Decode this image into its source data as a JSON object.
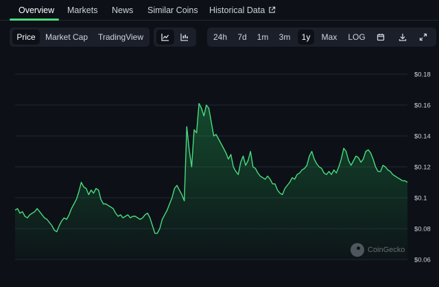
{
  "nav": {
    "tabs": [
      {
        "label": "Overview",
        "active": true
      },
      {
        "label": "Markets"
      },
      {
        "label": "News"
      },
      {
        "label": "Similar Coins"
      },
      {
        "label": "Historical Data"
      }
    ]
  },
  "toolbar": {
    "view_tabs": [
      {
        "label": "Price",
        "active": true
      },
      {
        "label": "Market Cap"
      },
      {
        "label": "TradingView"
      }
    ],
    "chart_types": [
      {
        "icon": "line-chart-icon",
        "active": true
      },
      {
        "icon": "candlestick-chart-icon"
      }
    ],
    "ranges": [
      {
        "label": "24h"
      },
      {
        "label": "7d"
      },
      {
        "label": "1m"
      },
      {
        "label": "3m"
      },
      {
        "label": "1y",
        "active": true
      },
      {
        "label": "Max"
      },
      {
        "label": "LOG"
      }
    ],
    "actions": [
      {
        "icon": "calendar-icon"
      },
      {
        "icon": "download-icon"
      },
      {
        "icon": "fullscreen-icon"
      }
    ]
  },
  "watermark": "CoinGecko",
  "colors": {
    "background": "#0d1117",
    "line": "#4ade80",
    "accent": "#4ade80",
    "gridline": "#1f2937"
  },
  "chart_data": {
    "type": "area",
    "y_ticks": [
      "$0.18",
      "$0.16",
      "$0.14",
      "$0.12",
      "$0.1",
      "$0.08",
      "$0.06"
    ],
    "ylim": [
      0.06,
      0.18
    ],
    "grid": true,
    "x": [
      0,
      1,
      2,
      3,
      4,
      5,
      6,
      7,
      8,
      9,
      10,
      11,
      12,
      13,
      14,
      15,
      16,
      17,
      18,
      19,
      20,
      21,
      22,
      23,
      24,
      25,
      26,
      27,
      28,
      29,
      30,
      31,
      32,
      33,
      34,
      35,
      36,
      37,
      38,
      39,
      40,
      41,
      42,
      43,
      44,
      45,
      46,
      47,
      48,
      49,
      50,
      51,
      52,
      53,
      54,
      55,
      56,
      57,
      58,
      59,
      60,
      61,
      62,
      63,
      64,
      65,
      66,
      67,
      68,
      69,
      70,
      71,
      72,
      73,
      74,
      75,
      76,
      77,
      78,
      79,
      80,
      81,
      82,
      83,
      84,
      85,
      86,
      87,
      88,
      89,
      90,
      91,
      92,
      93,
      94,
      95,
      96,
      97,
      98,
      99,
      100,
      101,
      102,
      103,
      104,
      105,
      106,
      107,
      108,
      109,
      110,
      111,
      112,
      113,
      114,
      115,
      116,
      117,
      118,
      119,
      120,
      121,
      122,
      123,
      124,
      125,
      126,
      127,
      128,
      129,
      130,
      131,
      132,
      133,
      134,
      135,
      136,
      137,
      138,
      139,
      140,
      141,
      142,
      143,
      144,
      145,
      146,
      147,
      148,
      149,
      150,
      151,
      152,
      153,
      154,
      155,
      156,
      157,
      158,
      159,
      160
    ],
    "series": [
      {
        "values": [
          0.092,
          0.093,
          0.09,
          0.091,
          0.088,
          0.087,
          0.089,
          0.09,
          0.091,
          0.093,
          0.091,
          0.089,
          0.087,
          0.086,
          0.084,
          0.082,
          0.079,
          0.078,
          0.082,
          0.085,
          0.087,
          0.086,
          0.089,
          0.093,
          0.096,
          0.099,
          0.104,
          0.11,
          0.107,
          0.106,
          0.102,
          0.105,
          0.103,
          0.106,
          0.105,
          0.099,
          0.096,
          0.096,
          0.095,
          0.094,
          0.093,
          0.09,
          0.088,
          0.089,
          0.087,
          0.088,
          0.089,
          0.087,
          0.088,
          0.088,
          0.087,
          0.086,
          0.087,
          0.089,
          0.09,
          0.087,
          0.082,
          0.077,
          0.077,
          0.08,
          0.086,
          0.089,
          0.092,
          0.096,
          0.1,
          0.106,
          0.108,
          0.105,
          0.102,
          0.098,
          0.146,
          0.131,
          0.12,
          0.144,
          0.142,
          0.161,
          0.158,
          0.153,
          0.16,
          0.158,
          0.149,
          0.14,
          0.141,
          0.138,
          0.135,
          0.132,
          0.129,
          0.125,
          0.128,
          0.12,
          0.117,
          0.115,
          0.123,
          0.127,
          0.121,
          0.124,
          0.13,
          0.12,
          0.119,
          0.116,
          0.114,
          0.113,
          0.112,
          0.114,
          0.112,
          0.109,
          0.109,
          0.105,
          0.103,
          0.102,
          0.106,
          0.108,
          0.11,
          0.113,
          0.112,
          0.115,
          0.116,
          0.118,
          0.119,
          0.121,
          0.127,
          0.13,
          0.125,
          0.122,
          0.12,
          0.119,
          0.116,
          0.115,
          0.117,
          0.115,
          0.118,
          0.116,
          0.12,
          0.125,
          0.132,
          0.13,
          0.124,
          0.121,
          0.124,
          0.127,
          0.126,
          0.123,
          0.125,
          0.13,
          0.131,
          0.129,
          0.125,
          0.12,
          0.117,
          0.117,
          0.121,
          0.12,
          0.118,
          0.117,
          0.115,
          0.114,
          0.113,
          0.112,
          0.111,
          0.111,
          0.11
        ]
      }
    ]
  }
}
